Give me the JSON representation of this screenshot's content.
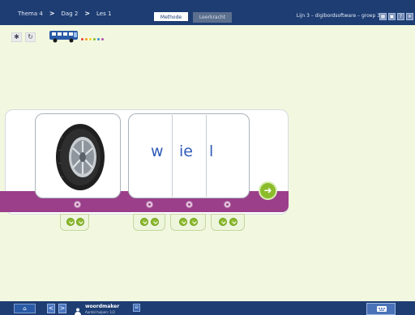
{
  "topbar": {
    "breadcrumbs": [
      {
        "label": "Thema 4"
      },
      {
        "label": "Dag 2"
      },
      {
        "label": "Les 1"
      }
    ],
    "separator": ">",
    "tabs": [
      {
        "label": "Methode",
        "active": true
      },
      {
        "label": "Leerkracht",
        "active": false
      }
    ],
    "suite_title": "Lijn 3 – digibordsoftware – groep 3",
    "icons": [
      "grid-icon",
      "board-icon",
      "help-icon",
      "close-icon"
    ],
    "icon_glyphs": [
      "▦",
      "▣",
      "?",
      "✕"
    ]
  },
  "toolbar": {
    "settings_glyph": "✱",
    "refresh_glyph": "↻",
    "dot_colors": [
      "#e8403a",
      "#f29b1d",
      "#f6d31e",
      "#8cbc2c",
      "#3a8fd6",
      "#b24fa6"
    ]
  },
  "exercise": {
    "picture": "car-tire",
    "word_parts": [
      "w",
      "ie",
      "l"
    ],
    "next_glyph": "➜"
  },
  "bottombar": {
    "home_glyph": "⌂",
    "prev_glyph": "<",
    "next_glyph": ">",
    "brand": "woordmaker",
    "brand_subtitle": "Aantal hulpen: 1/2",
    "small_button_glyph": "⊟",
    "keyboard_icon": "keyboard-icon"
  },
  "colors": {
    "topbar": "#1d3d73",
    "background": "#f2f8e0",
    "band": "#9b3f8a",
    "accent_green": "#8cbc2c",
    "letter_blue": "#2f5bb8"
  }
}
